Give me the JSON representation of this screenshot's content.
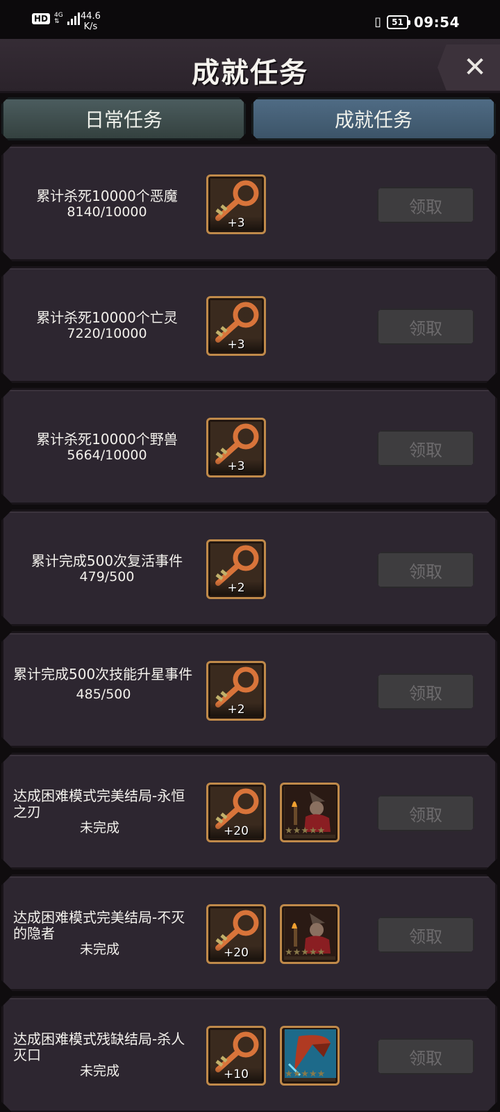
{
  "status_bar": {
    "hd": "HD",
    "network": "4G",
    "speed_value": "44.6",
    "speed_unit": "K/s",
    "battery": "51",
    "time": "09:54"
  },
  "header": {
    "title": "成就任务",
    "close_symbol": "✕"
  },
  "tabs": [
    {
      "label": "日常任务",
      "active": false
    },
    {
      "label": "成就任务",
      "active": true
    }
  ],
  "tasks": [
    {
      "name": "累计杀死10000个恶魔",
      "progress": "8140/10000",
      "rewards": [
        {
          "type": "key",
          "amount": "+3"
        }
      ],
      "claim": "领取"
    },
    {
      "name": "累计杀死10000个亡灵",
      "progress": "7220/10000",
      "rewards": [
        {
          "type": "key",
          "amount": "+3"
        }
      ],
      "claim": "领取"
    },
    {
      "name": "累计杀死10000个野兽",
      "progress": "5664/10000",
      "rewards": [
        {
          "type": "key",
          "amount": "+3"
        }
      ],
      "claim": "领取"
    },
    {
      "name": "累计完成500次复活事件",
      "progress": "479/500",
      "rewards": [
        {
          "type": "key",
          "amount": "+2"
        }
      ],
      "claim": "领取"
    },
    {
      "name": "累计完成500次技能升星事件",
      "progress": "485/500",
      "rewards": [
        {
          "type": "key",
          "amount": "+2"
        }
      ],
      "claim": "领取"
    },
    {
      "name": "达成困难模式完美结局-永恒之刃",
      "progress": "未完成",
      "rewards": [
        {
          "type": "key",
          "amount": "+20"
        },
        {
          "type": "character-portrait"
        }
      ],
      "claim": "领取"
    },
    {
      "name": "达成困难模式完美结局-不灭的隐者",
      "progress": "未完成",
      "rewards": [
        {
          "type": "key",
          "amount": "+20"
        },
        {
          "type": "character-portrait"
        }
      ],
      "claim": "领取"
    },
    {
      "name": "达成困难模式残缺结局-杀人灭口",
      "progress": "未完成",
      "rewards": [
        {
          "type": "key",
          "amount": "+10"
        },
        {
          "type": "skill-portrait"
        }
      ],
      "claim": "领取"
    }
  ],
  "colors": {
    "card_bg": "#2d2630",
    "reward_border": "#c08a4a",
    "key_color": "#d8743a",
    "active_tab": "#4f6b84",
    "inactive_tab": "#4b5c5e",
    "claim_disabled": "#3e3d3f"
  }
}
